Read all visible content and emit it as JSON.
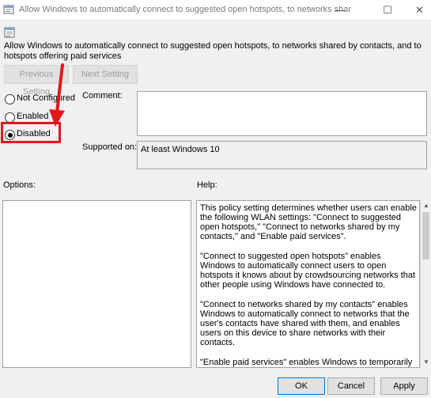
{
  "window": {
    "title": "Allow Windows to automatically connect to suggested open hotspots, to networks shared by co...",
    "minimize_glyph": "—",
    "maximize_glyph": "☐",
    "close_glyph": "✕"
  },
  "policy": {
    "description": "Allow Windows to automatically connect to suggested open hotspots, to networks shared by contacts, and to hotspots offering paid services"
  },
  "nav": {
    "previous_label": "Previous Setting",
    "next_label": "Next Setting"
  },
  "state": {
    "options": [
      {
        "label": "Not Configured",
        "selected": false
      },
      {
        "label": "Enabled",
        "selected": false
      },
      {
        "label": "Disabled",
        "selected": true
      }
    ]
  },
  "fields": {
    "comment_label": "Comment:",
    "comment_value": "",
    "supported_label": "Supported on:",
    "supported_value": "At least Windows 10"
  },
  "panels": {
    "options_label": "Options:",
    "help_label": "Help:",
    "help_paragraphs": [
      "This policy setting determines whether users can enable the following WLAN settings: \"Connect to suggested open hotspots,\" \"Connect to networks shared by my contacts,\" and \"Enable paid services\".",
      "\"Connect to suggested open hotspots\" enables Windows to automatically connect users to open hotspots it knows about by crowdsourcing networks that other people using Windows have connected to.",
      "\"Connect to networks shared by my contacts\" enables Windows to automatically connect to networks that the user's contacts have shared with them, and enables users on this device to share networks with their contacts.",
      "\"Enable paid services\" enables Windows to temporarily connect to open hotspots to determine if paid services are available."
    ]
  },
  "buttons": {
    "ok_label": "OK",
    "cancel_label": "Cancel",
    "apply_label": "Apply"
  },
  "colors": {
    "highlight": "#e3161b",
    "background": "#f0f0f0"
  }
}
